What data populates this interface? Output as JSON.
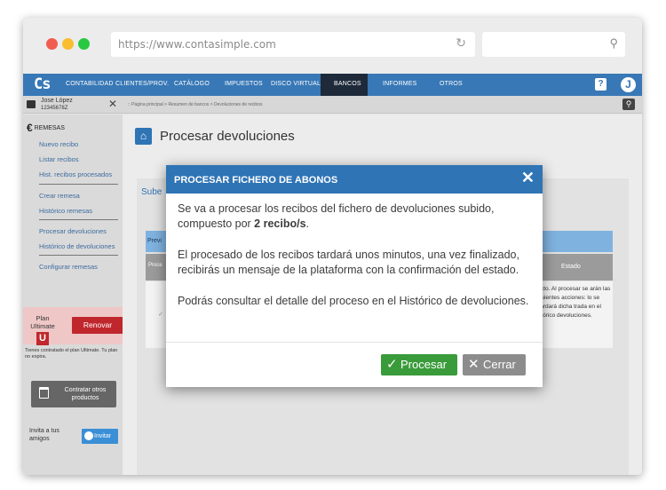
{
  "browser": {
    "url": "https://www.contasimple.com"
  },
  "nav": {
    "logo": "Cs",
    "items": [
      "CONTABILIDAD",
      "CLIENTES/PROV.",
      "CATÁLOGO",
      "IMPUESTOS",
      "DISCO VIRTUAL",
      "BANCOS",
      "INFORMES",
      "OTROS"
    ],
    "active": "BANCOS",
    "help": "?",
    "avatar": "J"
  },
  "userbar": {
    "name": "Jose López",
    "id": "12345678Z",
    "breadcrumb": ":: Página principal > Resumen de bancos > Devoluciones de recibos"
  },
  "sidebar": {
    "section": "REMESAS",
    "links": [
      "Nuevo recibo",
      "Listar recibos",
      "Hist. recibos procesados",
      "Crear remesa",
      "Histórico remesas",
      "Procesar devoluciones",
      "Histórico de devoluciones",
      "Configurar remesas"
    ],
    "plan_label": "Plan Ultimate",
    "plan_badge": "U",
    "renew_label": "Renovar",
    "plan_note": "Tienes contratado el plan Ultimate. Tu plan no expira.",
    "hire_label": "Contratar otros productos",
    "invite_text": "Invita a tus amigos",
    "invite_button": "Invitar"
  },
  "page": {
    "title": "Procesar devoluciones",
    "subtitle": "Sube",
    "table_title": "Previ",
    "col_proc": "Proce",
    "col_status": "Estado",
    "status_text": "rrecto. Al procesar se arán las siguientes acciones: lo se guardará dicha trada en el histórico devoluciones."
  },
  "modal": {
    "title": "PROCESAR FICHERO DE ABONOS",
    "close": "✕",
    "line1_pre": "Se va a procesar los recibos del fichero de devoluciones subido, compuesto por ",
    "line1_bold": "2 recibo/s",
    "line1_post": ".",
    "line2": "El procesado de los recibos tardará unos minutos, una vez finalizado, recibirás un mensaje de la plataforma con la confirmación del estado.",
    "line3": "Podrás consultar el detalle del proceso en el Histórico de devoluciones.",
    "btn_process": "Procesar",
    "btn_close": "Cerrar"
  },
  "colors": {
    "accent": "#2f74b5",
    "nav": "#3878b6",
    "success": "#3a9b3a",
    "danger": "#c0272d"
  }
}
